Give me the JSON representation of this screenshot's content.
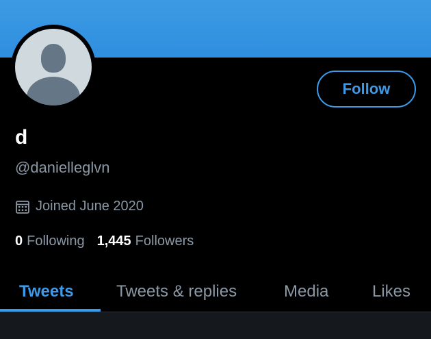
{
  "profile": {
    "display_name": "d",
    "handle": "@danielleglvn",
    "joined": "Joined June 2020",
    "following_count": "0",
    "following_label": "Following",
    "followers_count": "1,445",
    "followers_label": "Followers"
  },
  "actions": {
    "follow_label": "Follow"
  },
  "tabs": [
    {
      "label": "Tweets",
      "active": true
    },
    {
      "label": "Tweets & replies",
      "active": false
    },
    {
      "label": "Media",
      "active": false
    },
    {
      "label": "Likes",
      "active": false
    }
  ],
  "icons": {
    "avatar": "default-avatar-icon",
    "calendar": "calendar-icon"
  },
  "colors": {
    "banner": "#3c9ae3",
    "accent": "#3d9ae8",
    "background": "#000000",
    "secondary_text": "#8b98a5"
  }
}
